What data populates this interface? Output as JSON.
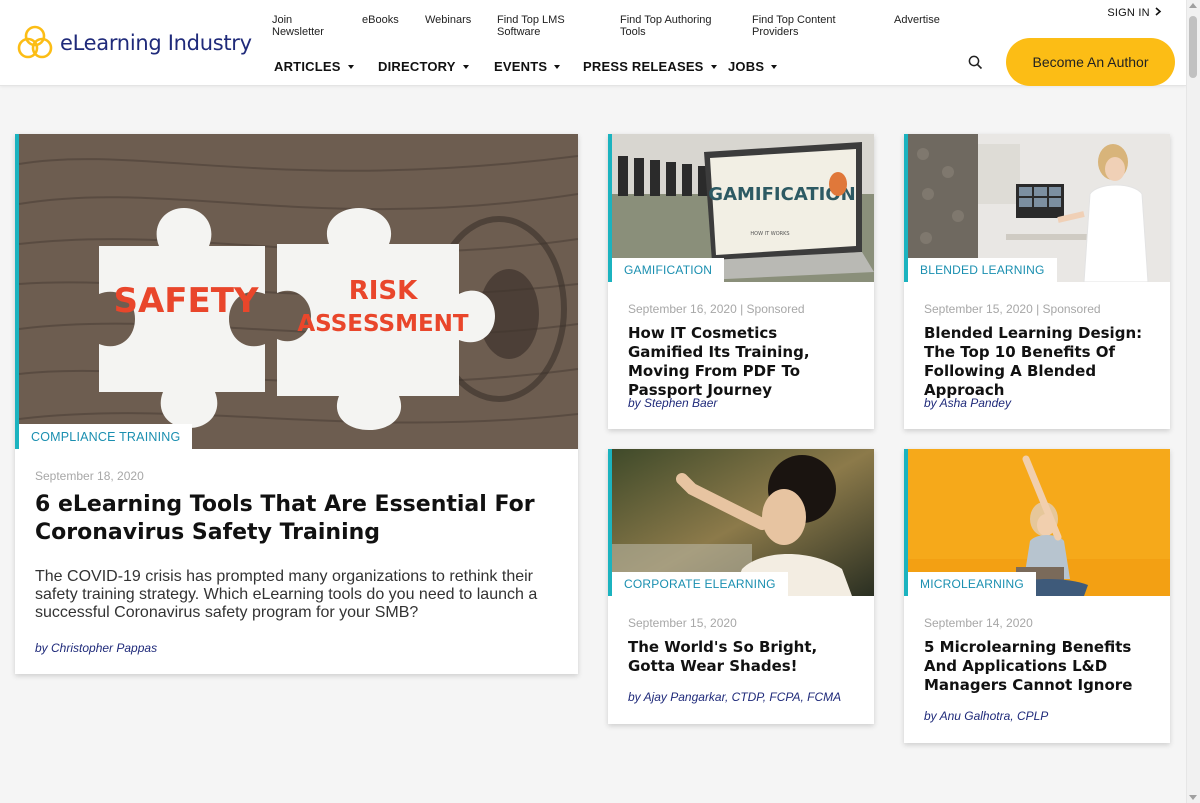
{
  "brand": {
    "name": "eLearning Industry",
    "colors": {
      "primary": "#1f2a7a",
      "accent": "#fcbd15",
      "teal": "#1bb3bf",
      "category": "#1a8fb0"
    }
  },
  "toplinks": [
    "Join Newsletter",
    "eBooks",
    "Webinars",
    "Find Top LMS Software",
    "Find Top Authoring Tools",
    "Find Top Content Providers",
    "Advertise"
  ],
  "nav": [
    "ARTICLES",
    "DIRECTORY",
    "EVENTS",
    "PRESS RELEASES",
    "JOBS"
  ],
  "signin": "SIGN IN",
  "become_author": "Become An Author",
  "featured": {
    "category": "COMPLIANCE TRAINING",
    "date": "September 18, 2020",
    "title": "6 eLearning Tools That Are Essential For Coronavirus Safety Training",
    "excerpt": "The COVID-19 crisis has prompted many organizations to rethink their safety training strategy. Which eLearning tools do you need to launch a successful Coronavirus safety program for your SMB?",
    "author": "by Christopher Pappas",
    "image_text": {
      "piece1": "SAFETY",
      "piece2a": "RISK",
      "piece2b": "ASSESSMENT"
    }
  },
  "articles": [
    {
      "category": "GAMIFICATION",
      "meta": "September 16, 2020 | Sponsored",
      "title": "How IT Cosmetics Gamified Its Training, Moving From PDF To Passport Journey",
      "author": "by Stephen Baer",
      "image_text": "GAMIFICATION",
      "image_subtext": "HOW IT WORKS"
    },
    {
      "category": "BLENDED LEARNING",
      "meta": "September 15, 2020 | Sponsored",
      "title": "Blended Learning Design: The Top 10 Benefits Of Following A Blended Approach",
      "author": "by Asha Pandey"
    },
    {
      "category": "CORPORATE ELEARNING",
      "meta": "September 15, 2020",
      "title": "The World's So Bright, Gotta Wear Shades!",
      "author": "by Ajay Pangarkar, CTDP, FCPA, FCMA"
    },
    {
      "category": "MICROLEARNING",
      "meta": "September 14, 2020",
      "title": "5 Microlearning Benefits And Applications L&D Managers Cannot Ignore",
      "author": "by Anu Galhotra, CPLP"
    }
  ]
}
